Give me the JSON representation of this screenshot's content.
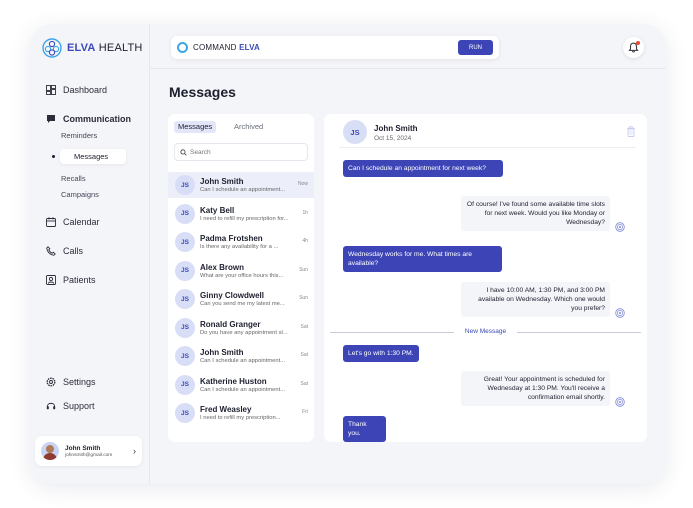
{
  "brand": {
    "name_bold": "ELVA",
    "name_thin": " HEALTH",
    "accent": "#3a4ab8"
  },
  "sidebar": {
    "items": [
      {
        "label": "Dashboard",
        "icon": "dashboard-icon"
      },
      {
        "label": "Communication",
        "icon": "chat-icon"
      },
      {
        "label": "Calendar",
        "icon": "calendar-icon"
      },
      {
        "label": "Calls",
        "icon": "phone-icon"
      },
      {
        "label": "Patients",
        "icon": "patients-icon"
      },
      {
        "label": "Settings",
        "icon": "gear-icon"
      },
      {
        "label": "Support",
        "icon": "headset-icon"
      }
    ],
    "sub_items": [
      "Reminders",
      "Messages",
      "Recalls",
      "Campaigns"
    ],
    "active_sub": "Messages"
  },
  "user": {
    "name": "John Smith",
    "email": "johnsmith@gmail.com"
  },
  "command": {
    "label": "COMMAND",
    "label_accent": "ELVA",
    "run": "RUN"
  },
  "page": {
    "title": "Messages"
  },
  "tabs": {
    "active": "Messages",
    "other": "Archived"
  },
  "search": {
    "placeholder": "Search"
  },
  "conversations": [
    {
      "initials": "JS",
      "name": "John Smith",
      "preview": "Can I schedule an appointment...",
      "time": "Now"
    },
    {
      "initials": "JS",
      "name": "Katy Bell",
      "preview": "I need to refill my prescription for...",
      "time": "1h"
    },
    {
      "initials": "JS",
      "name": "Padma Frotshen",
      "preview": "Is there any availability for a ...",
      "time": "4h"
    },
    {
      "initials": "JS",
      "name": "Alex Brown",
      "preview": "What are your office hours this...",
      "time": "Sun"
    },
    {
      "initials": "JS",
      "name": "Ginny Clowdwell",
      "preview": "Can you send me my latest me...",
      "time": "Sun"
    },
    {
      "initials": "JS",
      "name": "Ronald Granger",
      "preview": "Do you have any appointment sl...",
      "time": "Sat"
    },
    {
      "initials": "JS",
      "name": "John Smith",
      "preview": "Can I schedule an appointment...",
      "time": "Sat"
    },
    {
      "initials": "JS",
      "name": "Katherine Huston",
      "preview": "Can I schedule an appointment...",
      "time": "Sat"
    },
    {
      "initials": "JS",
      "name": "Fred Weasley",
      "preview": "I need to refill my prescription...",
      "time": "Fri"
    }
  ],
  "chat": {
    "initials": "JS",
    "name": "John Smith",
    "date": "Oct 15, 2024",
    "divider": "New Message",
    "messages": [
      {
        "dir": "in",
        "text": "Can I schedule an appointment for next week?"
      },
      {
        "dir": "out",
        "text": "Of course! I've found some available time slots for next week. Would you like Monday or Wednesday?"
      },
      {
        "dir": "in",
        "text": "Wednesday works for me. What times are available?"
      },
      {
        "dir": "out",
        "text": "I have 10:00 AM, 1:30 PM, and 3:00 PM available on Wednesday. Which one would you prefer?"
      },
      {
        "dir": "in",
        "text": "Let's go with 1:30 PM."
      },
      {
        "dir": "out",
        "text": "Great! Your appointment is scheduled for Wednesday at 1:30 PM. You'll receive a confirmation email shortly."
      },
      {
        "dir": "in",
        "text": "Thank you."
      }
    ]
  }
}
